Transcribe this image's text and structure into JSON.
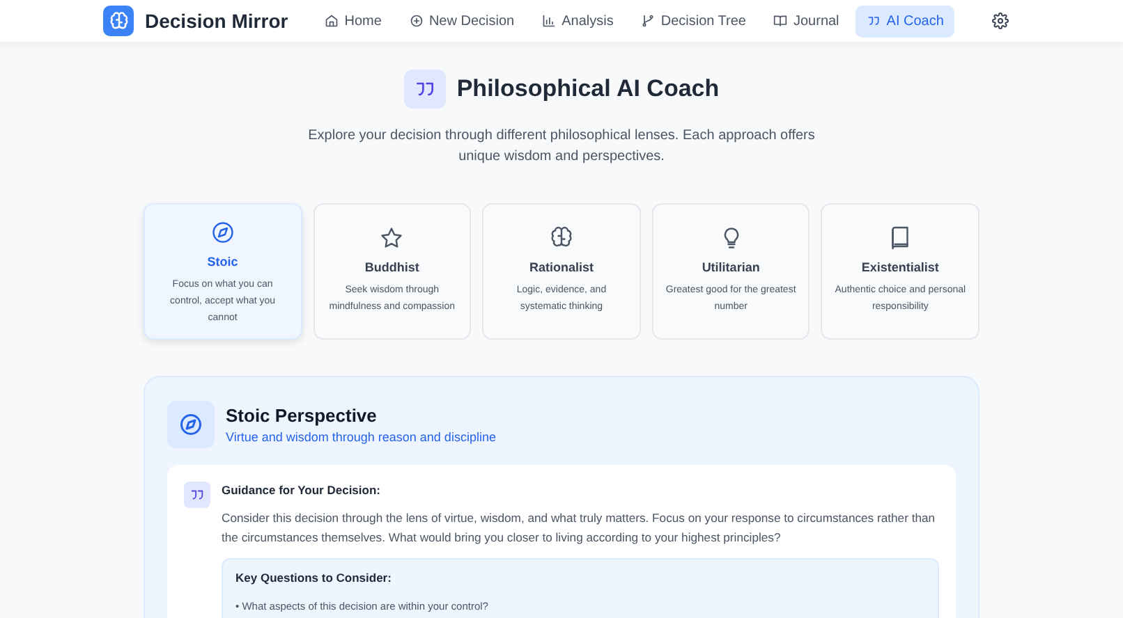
{
  "brand": {
    "name": "Decision Mirror"
  },
  "nav": [
    {
      "label": "Home",
      "selected": false
    },
    {
      "label": "New Decision",
      "selected": false
    },
    {
      "label": "Analysis",
      "selected": false
    },
    {
      "label": "Decision Tree",
      "selected": false
    },
    {
      "label": "Journal",
      "selected": false
    },
    {
      "label": "AI Coach",
      "selected": true
    }
  ],
  "header": {
    "title": "Philosophical AI Coach",
    "subtitle": "Explore your decision through different philosophical lenses. Each approach offers unique wisdom and perspectives."
  },
  "philosophies": [
    {
      "name": "Stoic",
      "description": "Focus on what you can control, accept what you cannot",
      "selected": true
    },
    {
      "name": "Buddhist",
      "description": "Seek wisdom through mindfulness and compassion",
      "selected": false
    },
    {
      "name": "Rationalist",
      "description": "Logic, evidence, and systematic thinking",
      "selected": false
    },
    {
      "name": "Utilitarian",
      "description": "Greatest good for the greatest number",
      "selected": false
    },
    {
      "name": "Existentialist",
      "description": "Authentic choice and personal responsibility",
      "selected": false
    }
  ],
  "perspective": {
    "title": "Stoic Perspective",
    "subtitle": "Virtue and wisdom through reason and discipline",
    "guidance": {
      "heading": "Guidance for Your Decision:",
      "text": "Consider this decision through the lens of virtue, wisdom, and what truly matters. Focus on your response to circumstances rather than the circumstances themselves. What would bring you closer to living according to your highest principles?"
    },
    "questions": {
      "heading": "Key Questions to Consider:",
      "items": [
        "• What aspects of this decision are within your control?"
      ]
    }
  }
}
